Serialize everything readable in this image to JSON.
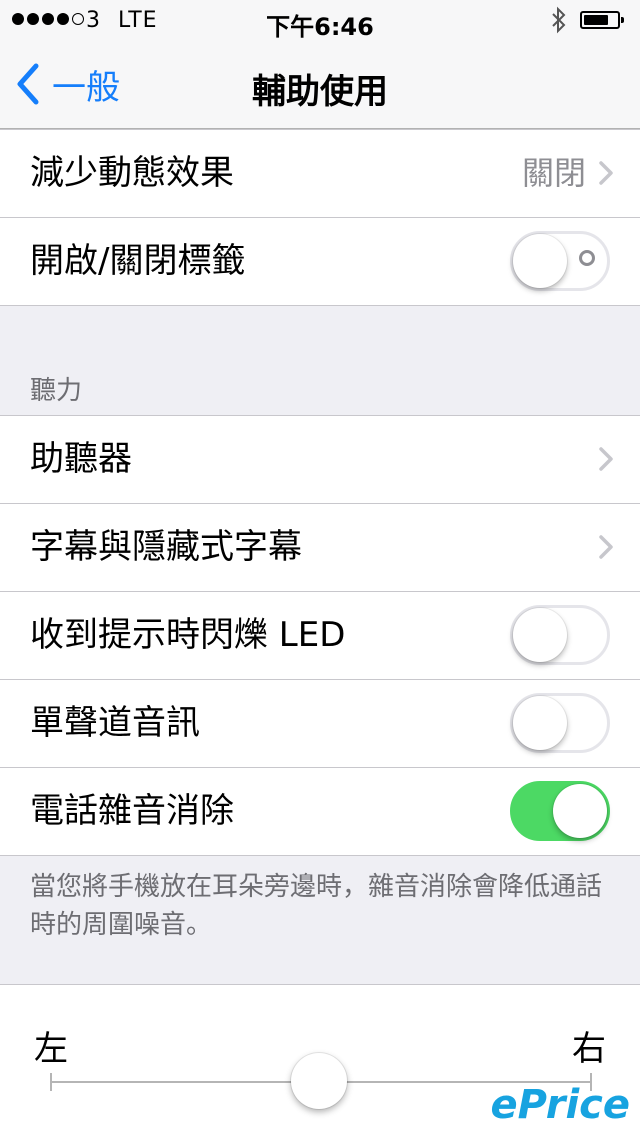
{
  "status_bar": {
    "carrier": "3",
    "network": "LTE",
    "time": "下午6:46",
    "bluetooth_icon": "bluetooth-icon",
    "battery_icon": "battery-icon",
    "battery_level": 0.75
  },
  "nav": {
    "back_label": "一般",
    "title": "輔助使用"
  },
  "vision_rows": [
    {
      "label": "減少動態效果",
      "detail": "關閉"
    },
    {
      "label": "開啟/關閉標籤",
      "toggle": false
    }
  ],
  "hearing": {
    "header": "聽力",
    "rows": [
      {
        "label": "助聽器"
      },
      {
        "label": "字幕與隱藏式字幕"
      },
      {
        "label": "收到提示時閃爍 LED",
        "toggle": false
      },
      {
        "label": "單聲道音訊",
        "toggle": false
      },
      {
        "label": "電話雜音消除",
        "toggle": true
      }
    ],
    "footer": "當您將手機放在耳朵旁邊時，雜音消除會降低通話時的周圍噪音。"
  },
  "balance": {
    "left_label": "左",
    "right_label": "右",
    "value": 0.5
  },
  "watermark": "ePrice",
  "colors": {
    "accent": "#157efb",
    "switch_on": "#4cd964"
  }
}
